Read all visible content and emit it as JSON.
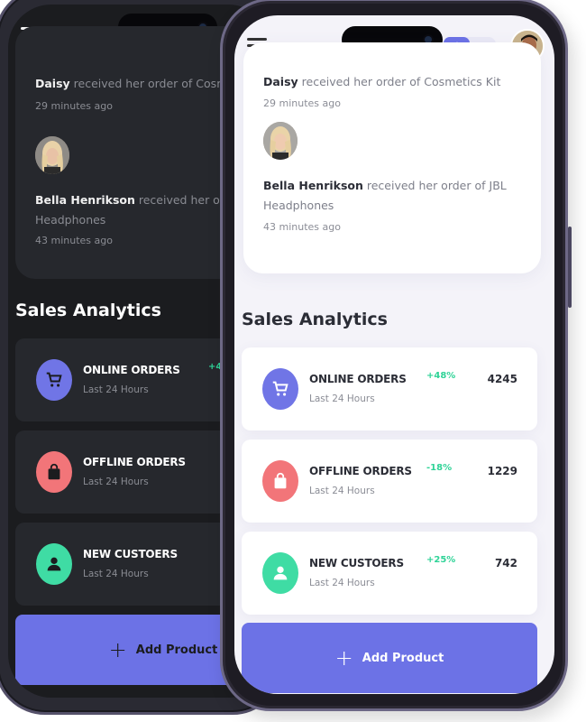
{
  "notifications": [
    {
      "name": "Daisy",
      "text": " received her order of Cosmetics Kit",
      "time": "29 minutes ago"
    },
    {
      "name": "Bella Henrikson",
      "text": " received her order of JBL Headphones",
      "time": "43 minutes ago"
    }
  ],
  "dark_notifications": [
    {
      "name": "Daisy",
      "text": " received her order of Cosme",
      "time": "29 minutes ago"
    },
    {
      "name": "Bella Henrikson",
      "text": " received her ord",
      "text2": "Headphones",
      "time": "43 minutes ago"
    }
  ],
  "analytics": {
    "title": "Sales Analytics",
    "items": [
      {
        "label": "ONLINE ORDERS",
        "sub": "Last 24 Hours",
        "pct": "+48%",
        "value": "4245",
        "color": "#7075e6",
        "icon": "cart-icon"
      },
      {
        "label": "OFFLINE ORDERS",
        "sub": "Last 24 Hours",
        "pct": "-18%",
        "value": "1229",
        "color": "#f27579",
        "icon": "bag-icon"
      },
      {
        "label": "NEW CUSTOERS",
        "sub": "Last 24 Hours",
        "pct": "+25%",
        "value": "742",
        "color": "#3fdca4",
        "icon": "person-icon"
      }
    ]
  },
  "add_button": {
    "plus": "+",
    "label": "Add Product"
  },
  "colors": {
    "accent": "#6c72e6",
    "positive": "#2fd397",
    "dark_bg": "#1b1c1f",
    "light_bg": "#f4f3f9"
  }
}
